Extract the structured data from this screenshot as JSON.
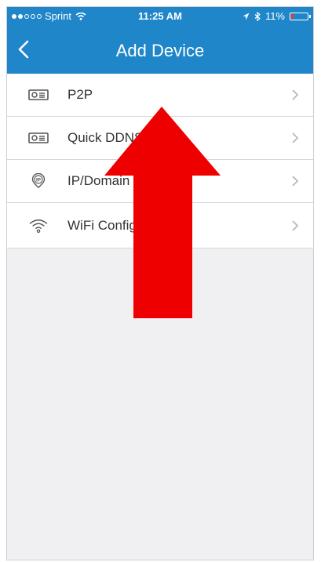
{
  "status_bar": {
    "carrier": "Sprint",
    "time": "11:25 AM",
    "battery": "11%"
  },
  "nav": {
    "title": "Add Device",
    "back_icon": "chevron-left-icon"
  },
  "list": {
    "items": [
      {
        "label": "P2P",
        "icon": "camera-device-icon"
      },
      {
        "label": "Quick DDNS",
        "icon": "camera-device-icon"
      },
      {
        "label": "IP/Domain",
        "icon": "ip-location-icon"
      },
      {
        "label": "WiFi Configuration",
        "icon": "wifi-icon"
      }
    ]
  },
  "colors": {
    "nav_background": "#1f86c9",
    "annotation_arrow": "#ef0000",
    "page_background": "#f0f0f2"
  },
  "annotation": {
    "type": "arrow",
    "direction": "up",
    "color": "#ef0000"
  }
}
